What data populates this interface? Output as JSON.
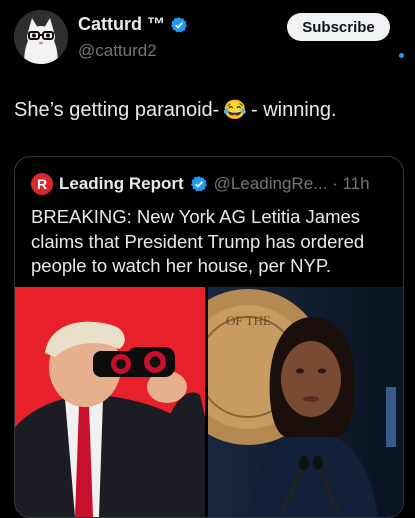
{
  "author": {
    "display_name": "Catturd ™",
    "handle": "@catturd2"
  },
  "subscribe_label": "Subscribe",
  "tweet": {
    "text_before": "She’s getting paranoid-",
    "emoji": "😂",
    "text_after": "- winning."
  },
  "quoted_tweet": {
    "logo_letter": "R",
    "display_name": "Leading Report",
    "handle_time": "@LeadingRe... · 11h",
    "text": "BREAKING: New York AG Letitia James claims that President Trump has ordered people to watch her house, per NYP."
  },
  "image_right": {
    "seal_text": "OF THE"
  },
  "colors": {
    "background": "#000000",
    "verified": "#1d9bf0",
    "subscribe_bg": "#eff3f4",
    "logo_red": "#d9282f",
    "image_left_bg": "#e8202a"
  }
}
